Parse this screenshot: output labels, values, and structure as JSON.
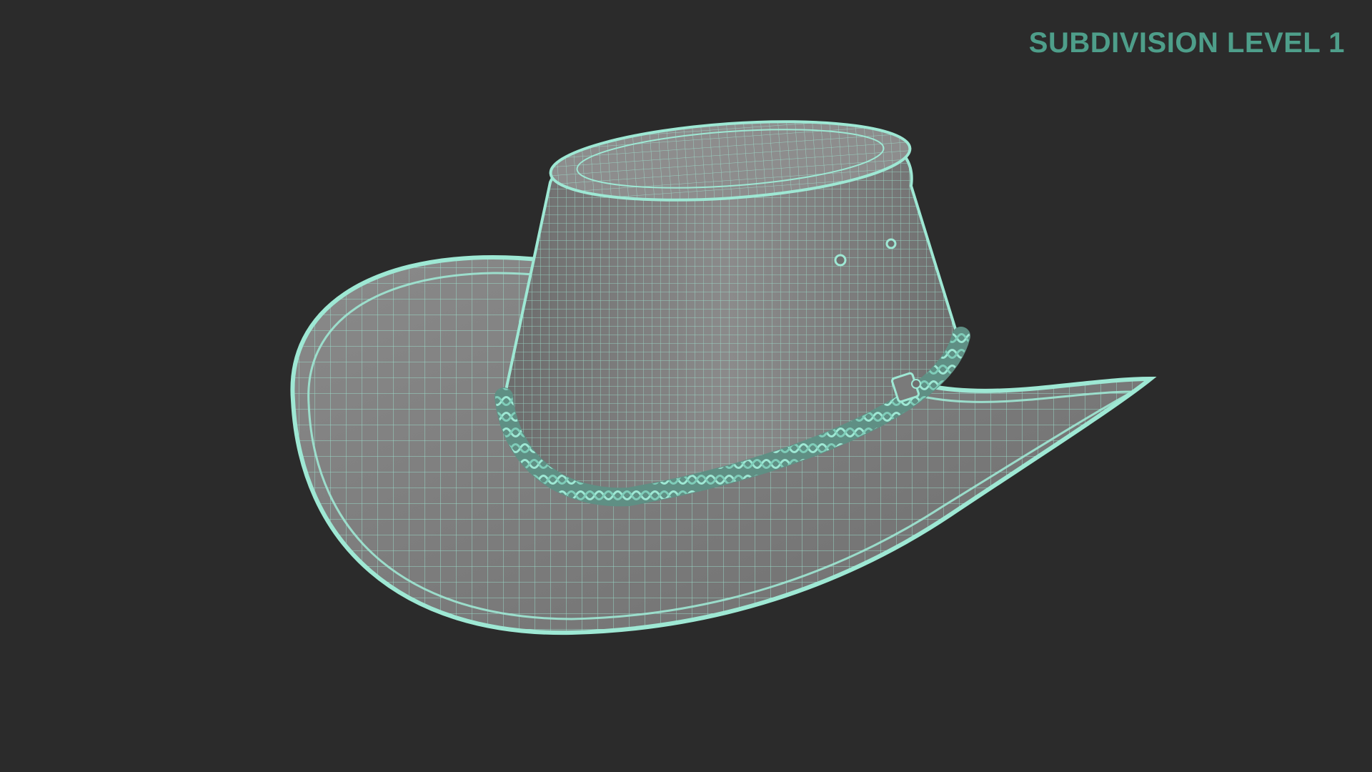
{
  "viewport": {
    "background": "#2b2b2b",
    "label": "SUBDIVISION LEVEL 1",
    "label_color": "#4e9e8a"
  },
  "model": {
    "object": "hat-icon",
    "surface_color": "#777777",
    "wire_color": "#9ee8d4"
  }
}
